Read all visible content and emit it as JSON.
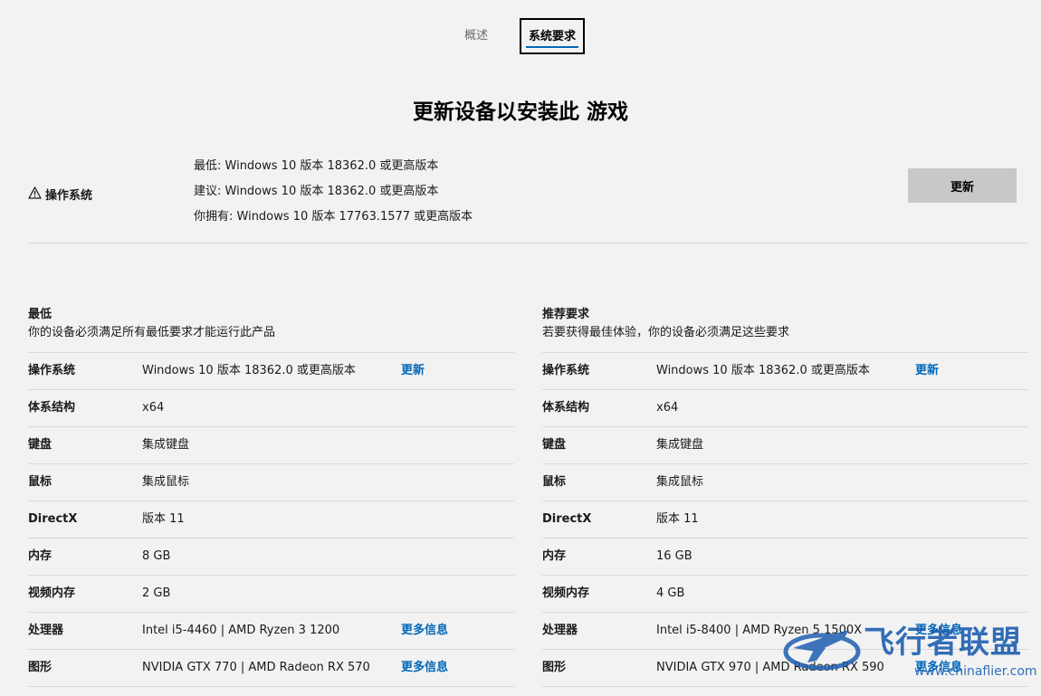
{
  "tabs": [
    {
      "label": "概述"
    },
    {
      "label": "系统要求"
    }
  ],
  "heading": "更新设备以安装此 游戏",
  "os_banner": {
    "label": "操作系统",
    "lines": [
      "最低: Windows 10 版本 18362.0 或更高版本",
      "建议: Windows 10 版本 18362.0 或更高版本",
      "你拥有: Windows 10 版本 17763.1577 或更高版本"
    ],
    "button_label": "更新"
  },
  "minimum": {
    "title": "最低",
    "description": "你的设备必须满足所有最低要求才能运行此产品",
    "rows": [
      {
        "label": "操作系统",
        "value": "Windows 10 版本 18362.0 或更高版本",
        "link": "更新"
      },
      {
        "label": "体系结构",
        "value": "x64"
      },
      {
        "label": "键盘",
        "value": "集成键盘"
      },
      {
        "label": "鼠标",
        "value": "集成鼠标"
      },
      {
        "label": "DirectX",
        "value": "版本 11"
      },
      {
        "label": "内存",
        "value": "8 GB"
      },
      {
        "label": "视频内存",
        "value": "2 GB"
      },
      {
        "label": "处理器",
        "value": "Intel i5-4460 | AMD Ryzen 3 1200",
        "link": "更多信息"
      },
      {
        "label": "图形",
        "value": "NVIDIA GTX 770 | AMD Radeon RX 570",
        "link": "更多信息"
      }
    ]
  },
  "recommended": {
    "title": "推荐要求",
    "description": "若要获得最佳体验，你的设备必须满足这些要求",
    "rows": [
      {
        "label": "操作系统",
        "value": "Windows 10 版本 18362.0 或更高版本",
        "link": "更新"
      },
      {
        "label": "体系结构",
        "value": "x64"
      },
      {
        "label": "键盘",
        "value": "集成键盘"
      },
      {
        "label": "鼠标",
        "value": "集成鼠标"
      },
      {
        "label": "DirectX",
        "value": "版本 11"
      },
      {
        "label": "内存",
        "value": "16 GB"
      },
      {
        "label": "视频内存",
        "value": "4 GB"
      },
      {
        "label": "处理器",
        "value": "Intel i5-8400 | AMD Ryzen 5 1500X",
        "link": "更多信息"
      },
      {
        "label": "图形",
        "value": "NVIDIA GTX 970 | AMD Radeon RX 590",
        "link": "更多信息"
      }
    ]
  },
  "watermark": {
    "text": "飞行者联盟",
    "url": "www.chinaflier.com"
  },
  "colors": {
    "background": "#f2f2f2",
    "link": "#0067b8",
    "button": "#c8c8c8",
    "divider": "#d9d9d9",
    "watermark": "#1e5fb0"
  },
  "icons": {
    "os_banner": "warning-icon",
    "watermark": "airplane-logo-icon"
  }
}
